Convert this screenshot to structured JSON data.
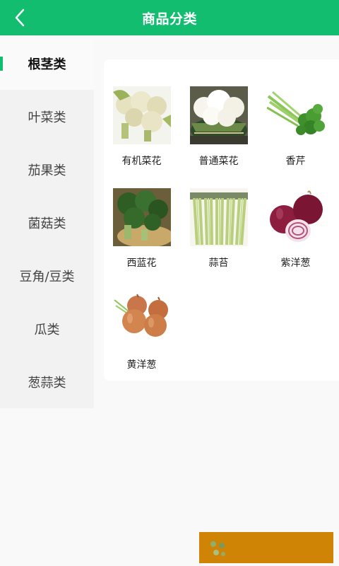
{
  "header": {
    "title": "商品分类"
  },
  "sidebar": {
    "items": [
      {
        "label": "根茎类",
        "active": true
      },
      {
        "label": "叶菜类"
      },
      {
        "label": "茄果类"
      },
      {
        "label": "菌菇类"
      },
      {
        "label": "豆角/豆类"
      },
      {
        "label": "瓜类"
      },
      {
        "label": "葱蒜类"
      }
    ]
  },
  "products": [
    {
      "name": "有机菜花"
    },
    {
      "name": "普通菜花"
    },
    {
      "name": "香芹"
    },
    {
      "name": "西蓝花"
    },
    {
      "name": "蒜苔"
    },
    {
      "name": "紫洋葱"
    },
    {
      "name": "黄洋葱"
    }
  ],
  "colors": {
    "accent": "#12bd70",
    "ad_background": "#cf8405"
  }
}
